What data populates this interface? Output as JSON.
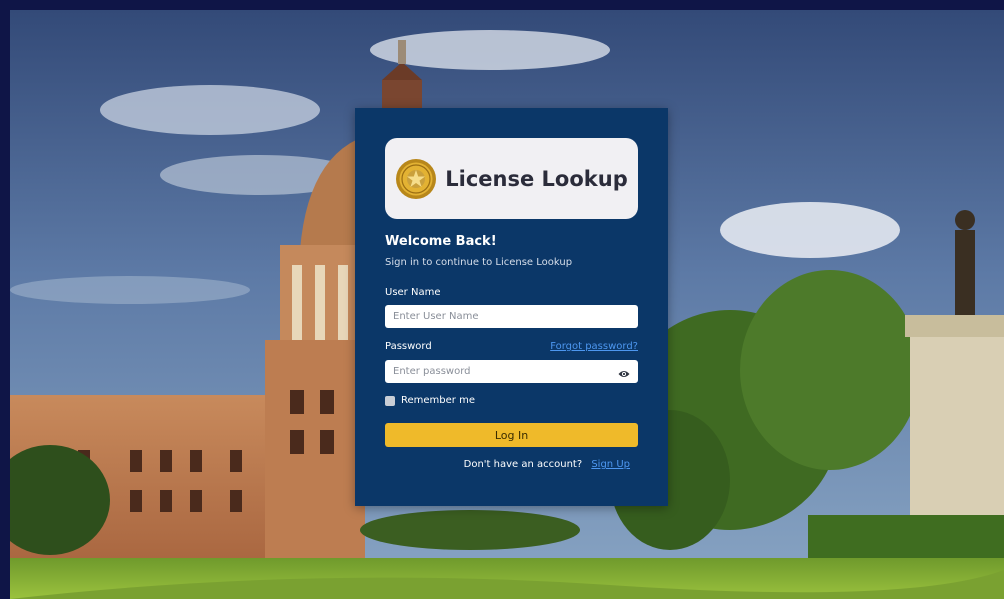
{
  "logo": {
    "text": "License Lookup",
    "icon": "seal-emblem-icon"
  },
  "header": {
    "title": "Welcome Back!",
    "subtitle": "Sign in to continue to License Lookup"
  },
  "form": {
    "username": {
      "label": "User Name",
      "placeholder": "Enter User Name",
      "value": ""
    },
    "password": {
      "label": "Password",
      "placeholder": "Enter password",
      "value": "",
      "visibility_icon": "eye-icon"
    },
    "forgot_label": "Forgot password?",
    "remember_label": "Remember me",
    "remember_checked": false,
    "submit_label": "Log In"
  },
  "signup": {
    "prompt": "Don't have an account?",
    "link_label": "Sign Up"
  },
  "colors": {
    "card": "#0b3768",
    "button": "#efba2a",
    "link": "#4d97f0",
    "frame": "#0f1547"
  }
}
